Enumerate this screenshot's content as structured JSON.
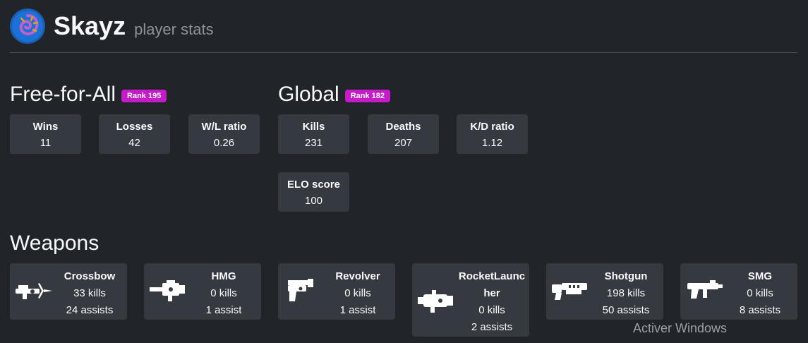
{
  "player": {
    "name": "Skayz",
    "subtitle": "player stats"
  },
  "ffa": {
    "title": "Free-for-All",
    "rank": "Rank 195",
    "stats": [
      {
        "label": "Wins",
        "value": "11"
      },
      {
        "label": "Losses",
        "value": "42"
      },
      {
        "label": "W/L ratio",
        "value": "0.26"
      }
    ]
  },
  "global": {
    "title": "Global",
    "rank": "Rank 182",
    "stats": [
      {
        "label": "Kills",
        "value": "231"
      },
      {
        "label": "Deaths",
        "value": "207"
      },
      {
        "label": "K/D ratio",
        "value": "1.12"
      },
      {
        "label": "ELO score",
        "value": "100"
      }
    ]
  },
  "weapons": {
    "title": "Weapons",
    "items": [
      {
        "name": "Crossbow",
        "kills": "33 kills",
        "assists": "24 assists",
        "icon": "crossbow-icon"
      },
      {
        "name": "HMG",
        "kills": "0 kills",
        "assists": "1 assist",
        "icon": "hmg-icon"
      },
      {
        "name": "Revolver",
        "kills": "0 kills",
        "assists": "1 assist",
        "icon": "revolver-icon"
      },
      {
        "name": "RocketLauncher",
        "kills": "0 kills",
        "assists": "2 assists",
        "icon": "rocket-launcher-icon"
      },
      {
        "name": "Shotgun",
        "kills": "198 kills",
        "assists": "50 assists",
        "icon": "shotgun-icon"
      },
      {
        "name": "SMG",
        "kills": "0 kills",
        "assists": "8 assists",
        "icon": "smg-icon"
      }
    ]
  },
  "watermark": "Activer Windows",
  "colors": {
    "background": "#212529",
    "card": "#343a40",
    "badge": "#c71ac9",
    "muted": "#8b939b"
  }
}
